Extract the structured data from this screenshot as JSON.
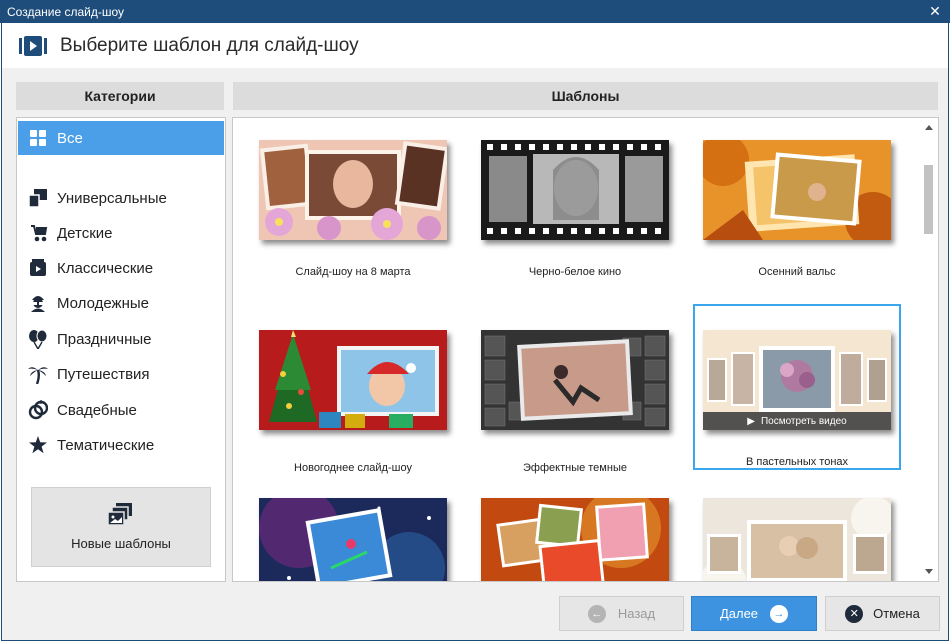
{
  "window": {
    "title": "Создание слайд-шоу",
    "close_glyph": "✕"
  },
  "header": {
    "title": "Выберите шаблон для слайд-шоу",
    "icon": "slideshow-play-icon"
  },
  "categories": {
    "heading": "Категории",
    "items": [
      {
        "label": "Все",
        "icon": "grid-icon",
        "selected": true
      },
      {
        "label": "Универсальные",
        "icon": "layers-icon"
      },
      {
        "label": "Детские",
        "icon": "stroller-icon"
      },
      {
        "label": "Классические",
        "icon": "film-icon"
      },
      {
        "label": "Молодежные",
        "icon": "hipster-icon"
      },
      {
        "label": "Праздничные",
        "icon": "balloons-icon"
      },
      {
        "label": "Путешествия",
        "icon": "palm-icon"
      },
      {
        "label": "Свадебные",
        "icon": "rings-icon"
      },
      {
        "label": "Тематические",
        "icon": "star-icon"
      }
    ],
    "new_templates_button": "Новые шаблоны"
  },
  "templates": {
    "heading": "Шаблоны",
    "items": [
      {
        "label": "Слайд-шоу на 8 марта"
      },
      {
        "label": "Черно-белое кино"
      },
      {
        "label": "Осенний вальс"
      },
      {
        "label": "Новогоднее слайд-шоу"
      },
      {
        "label": "Эффектные темные"
      },
      {
        "label": "В пастельных тонах",
        "selected": true,
        "overlay": "Посмотреть видео"
      },
      {
        "label": ""
      },
      {
        "label": ""
      },
      {
        "label": ""
      }
    ]
  },
  "footer": {
    "back": "Назад",
    "next": "Далее",
    "cancel": "Отмена"
  },
  "colors": {
    "titlebar": "#1e4d7b",
    "accent": "#3d93df",
    "selected_category": "#4a9fe8",
    "selected_frame": "#3aa6ee"
  }
}
